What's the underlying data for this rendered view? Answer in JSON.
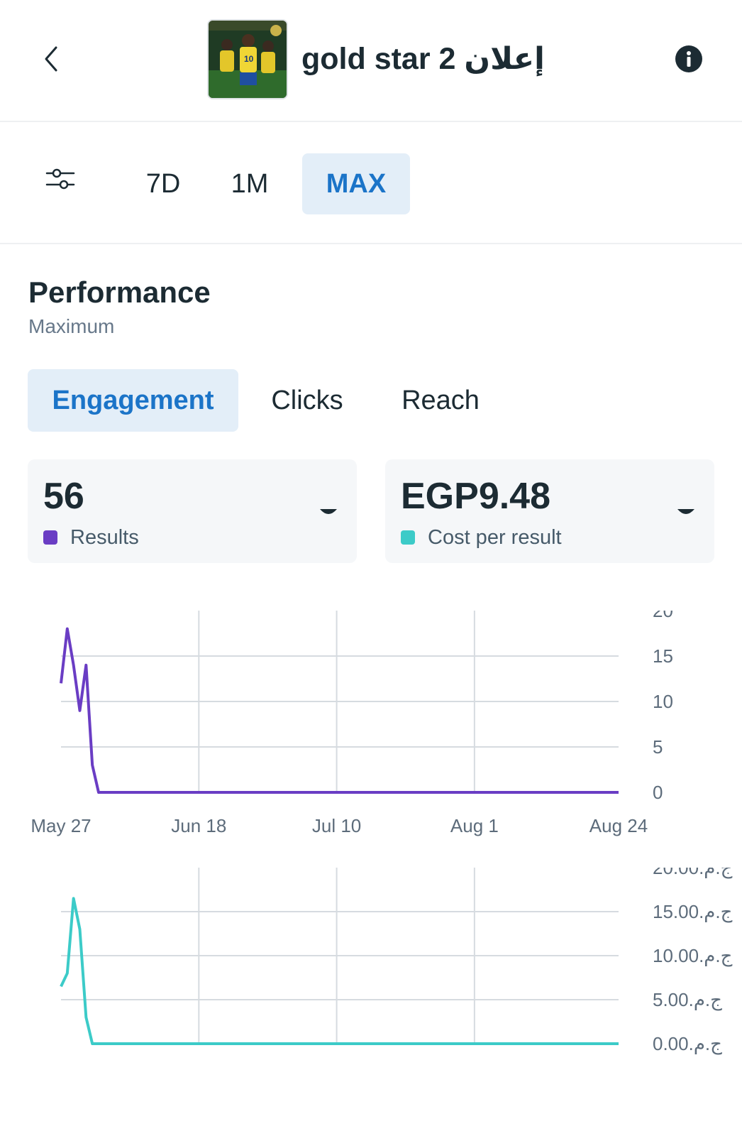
{
  "header": {
    "title": "gold star 2 إعلان"
  },
  "range_tabs": [
    {
      "label": "7D",
      "active": false
    },
    {
      "label": "1M",
      "active": false
    },
    {
      "label": "MAX",
      "active": true
    }
  ],
  "performance": {
    "title": "Performance",
    "subtitle": "Maximum"
  },
  "metric_tabs": [
    {
      "label": "Engagement",
      "active": true
    },
    {
      "label": "Clicks",
      "active": false
    },
    {
      "label": "Reach",
      "active": false
    }
  ],
  "cards": [
    {
      "value": "56",
      "label": "Results",
      "color": "#6a3dc4"
    },
    {
      "value": "EGP9.48",
      "label": "Cost per result",
      "color": "#3ccbc8"
    }
  ],
  "chart_data": [
    {
      "type": "line",
      "x": [
        "May 27",
        "May 28",
        "May 29",
        "May 30",
        "May 31",
        "Jun 1",
        "Jun 2",
        "Jun 3",
        "Jun 4",
        "Jun 5",
        "Aug 24"
      ],
      "series": [
        {
          "values": [
            12,
            18,
            14,
            9,
            14,
            3,
            0,
            0,
            0,
            0,
            0
          ],
          "color": "#6a3dc4"
        }
      ],
      "xticks": [
        "May 27",
        "Jun 18",
        "Jul 10",
        "Aug 1",
        "Aug 24"
      ],
      "yticks": [
        "0",
        "5",
        "10",
        "15",
        "20"
      ],
      "ylim": [
        0,
        20
      ],
      "grid": true
    },
    {
      "type": "line",
      "x": [
        "May 27",
        "May 28",
        "May 29",
        "May 30",
        "May 31",
        "Jun 1",
        "Jun 2",
        "Jun 3",
        "Aug 24"
      ],
      "series": [
        {
          "values": [
            6.5,
            8,
            16.5,
            13,
            3,
            0,
            0,
            0,
            0
          ],
          "color": "#3ccbc8"
        }
      ],
      "yticks": [
        "0.00.ج.م",
        "5.00.ج.م",
        "10.00.ج.م",
        "15.00.ج.م",
        "20.00.ج.م"
      ],
      "ylim": [
        0,
        20
      ],
      "grid": true
    }
  ]
}
